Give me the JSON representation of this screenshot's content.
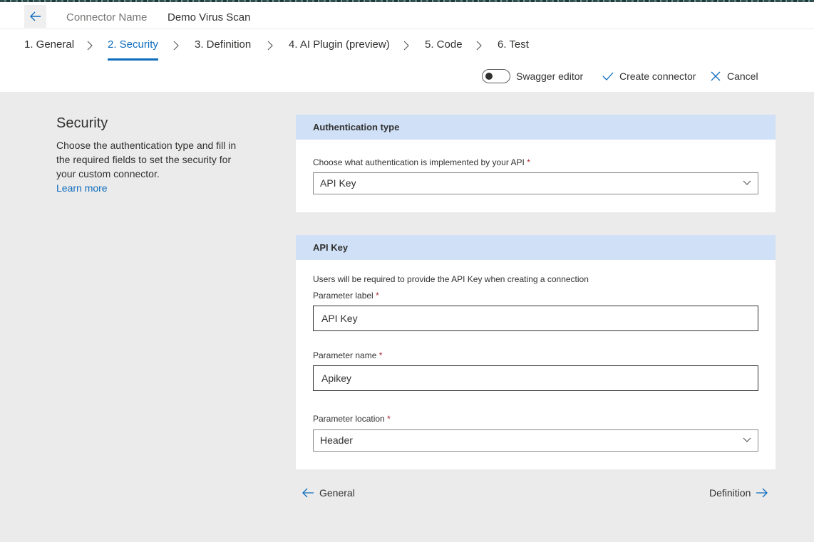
{
  "header": {
    "connector_name_label": "Connector Name",
    "connector_name_value": "Demo Virus Scan"
  },
  "steps": [
    {
      "label": "1. General"
    },
    {
      "label": "2. Security",
      "active": true
    },
    {
      "label": "3. Definition"
    },
    {
      "label": "4. AI Plugin (preview)"
    },
    {
      "label": "5. Code"
    },
    {
      "label": "6. Test"
    }
  ],
  "toolbar": {
    "swagger_label": "Swagger editor",
    "swagger_on": false,
    "create_label": "Create connector",
    "cancel_label": "Cancel"
  },
  "left": {
    "title": "Security",
    "description": "Choose the authentication type and fill in the required fields to set the security for your custom connector.",
    "learn_more": "Learn more"
  },
  "auth_card": {
    "header": "Authentication type",
    "field_label": "Choose what authentication is implemented by your API",
    "required_mark": "*",
    "selected": "API Key"
  },
  "apikey_card": {
    "header": "API Key",
    "info": "Users will be required to provide the API Key when creating a connection",
    "param_label_label": "Parameter label",
    "param_label_value": "API Key",
    "param_name_label": "Parameter name",
    "param_name_value": "Apikey",
    "param_location_label": "Parameter location",
    "param_location_value": "Header",
    "required_mark": "*"
  },
  "nav": {
    "prev": "General",
    "next": "Definition"
  },
  "colors": {
    "accent": "#0f6cbd",
    "card_header": "#cfe0f7",
    "page_bg": "#ebebeb"
  }
}
